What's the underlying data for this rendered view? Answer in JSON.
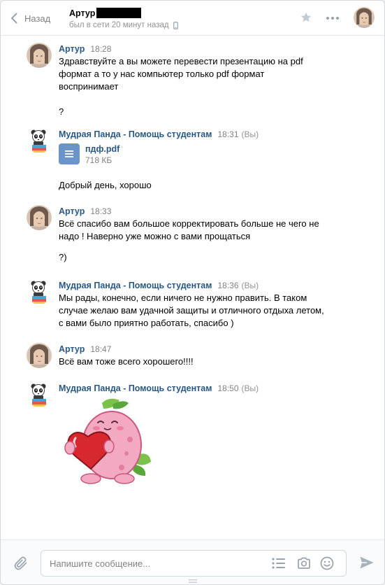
{
  "header": {
    "back_label": "Назад",
    "peer_name": "Артур",
    "peer_status": "был в сети 20 минут назад"
  },
  "messages": [
    {
      "author": "Артур",
      "time": "18:28",
      "lines": [
        "Здравствуйте а вы можете перевести презентацию на pdf",
        "формат а то у нас компьютер только pdf формат",
        "воспринимает",
        "",
        "?"
      ]
    },
    {
      "author": "Мудрая Панда - Помощь студентам",
      "time": "18:31",
      "you": "(Вы)",
      "doc": {
        "name": "пдф.pdf",
        "size": "718 КБ"
      },
      "lines": [
        "Добрый день, хорошо"
      ]
    },
    {
      "author": "Артур",
      "time": "18:33",
      "lines": [
        "Всё спасибо вам большое корректировать больше не чего не",
        "надо ! Наверно уже можно с вами прощаться",
        "",
        "?)"
      ]
    },
    {
      "author": "Мудрая Панда - Помощь студентам",
      "time": "18:36",
      "you": "(Вы)",
      "lines": [
        "Мы рады, конечно, если ничего не нужно править. В таком",
        "случае желаю вам удачной защиты и отличного отдыха летом,",
        "с вами было приятно работать, спасибо )"
      ]
    },
    {
      "author": "Артур",
      "time": "18:47",
      "lines": [
        "Всё вам тоже всего хорошего!!!!"
      ]
    },
    {
      "author": "Мудрая Панда - Помощь студентам",
      "time": "18:50",
      "you": "(Вы)",
      "sticker": "pink-creature-hugging-heart"
    }
  ],
  "composer": {
    "placeholder": "Напишите сообщение..."
  },
  "colors": {
    "link": "#2a5885",
    "meta": "#828282",
    "doc_icon": "#6b95c9",
    "border": "#e7e8ec"
  }
}
